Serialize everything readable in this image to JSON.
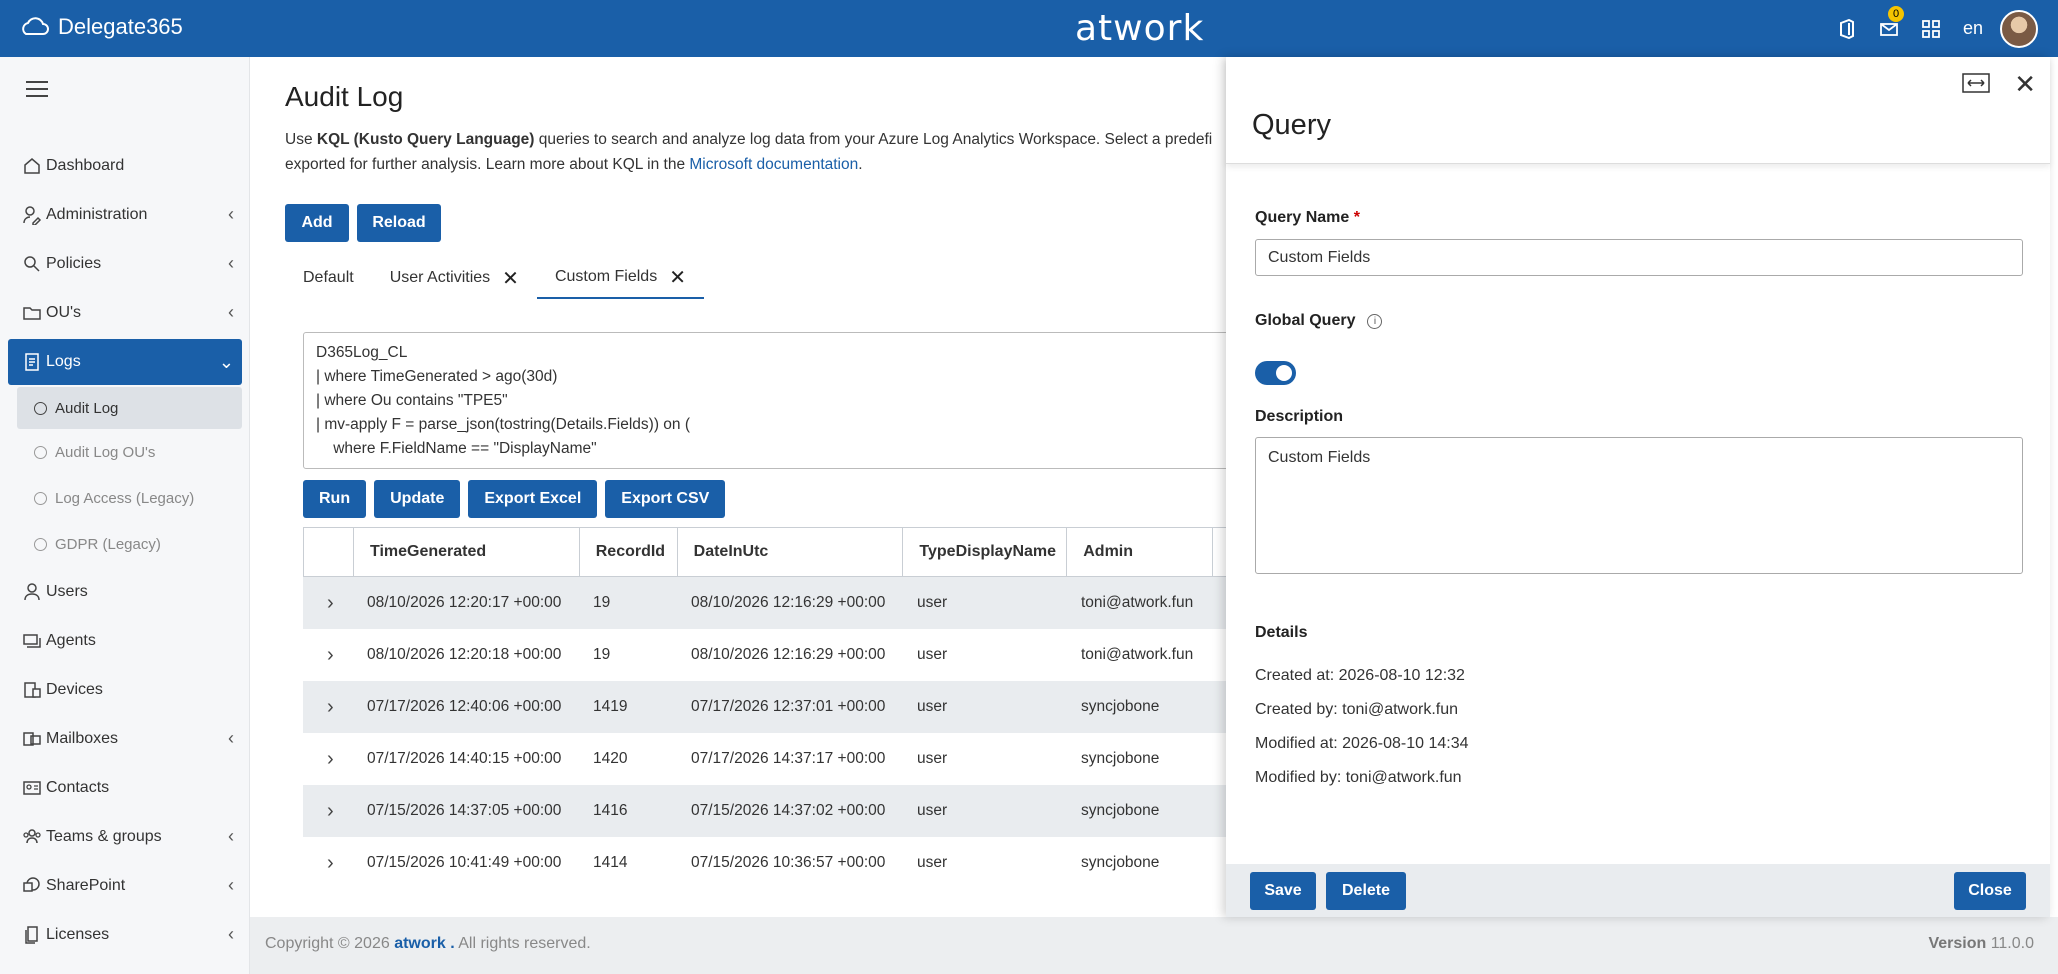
{
  "header": {
    "app_name": "Delegate365",
    "logo": "atwork",
    "notification_count": "0",
    "language": "en"
  },
  "sidebar": {
    "items": [
      {
        "label": "Dashboard",
        "icon": "home-icon"
      },
      {
        "label": "Administration",
        "icon": "admin-icon"
      },
      {
        "label": "Policies",
        "icon": "policies-icon"
      },
      {
        "label": "OU's",
        "icon": "folder-icon"
      },
      {
        "label": "Logs",
        "icon": "logs-icon"
      },
      {
        "label": "Users",
        "icon": "user-icon"
      },
      {
        "label": "Agents",
        "icon": "agents-icon"
      },
      {
        "label": "Devices",
        "icon": "devices-icon"
      },
      {
        "label": "Mailboxes",
        "icon": "mailboxes-icon"
      },
      {
        "label": "Contacts",
        "icon": "contacts-icon"
      },
      {
        "label": "Teams & groups",
        "icon": "teams-icon"
      },
      {
        "label": "SharePoint",
        "icon": "sharepoint-icon"
      },
      {
        "label": "Licenses",
        "icon": "licenses-icon"
      }
    ],
    "logs_sub": [
      "Audit Log",
      "Audit Log OU's",
      "Log Access (Legacy)",
      "GDPR (Legacy)"
    ]
  },
  "main": {
    "title": "Audit Log",
    "desc_prefix": "Use ",
    "desc_bold": "KQL (Kusto Query Language)",
    "desc_rest": " queries to search and analyze log data from your Azure Log Analytics Workspace. Select a predefi",
    "desc_line2": "exported for further analysis. Learn more about KQL in the ",
    "desc_link": "Microsoft documentation",
    "desc_end": ".",
    "add_label": "Add",
    "reload_label": "Reload",
    "tabs": [
      "Default",
      "User Activities",
      "Custom Fields"
    ],
    "query_text": "D365Log_CL\n| where TimeGenerated > ago(30d)\n| where Ou contains \"TPE5\"\n| mv-apply F = parse_json(tostring(Details.Fields)) on (\n    where F.FieldName == \"DisplayName\"",
    "run_label": "Run",
    "update_label": "Update",
    "export_excel_label": "Export Excel",
    "export_csv_label": "Export CSV",
    "columns": [
      "TimeGenerated",
      "RecordId",
      "DateInUtc",
      "TypeDisplayName",
      "Admin"
    ],
    "rows": [
      [
        "08/10/2026 12:20:17 +00:00",
        "19",
        "08/10/2026 12:16:29 +00:00",
        "user",
        "toni@atwork.fun"
      ],
      [
        "08/10/2026 12:20:18 +00:00",
        "19",
        "08/10/2026 12:16:29 +00:00",
        "user",
        "toni@atwork.fun"
      ],
      [
        "07/17/2026 12:40:06 +00:00",
        "1419",
        "07/17/2026 12:37:01 +00:00",
        "user",
        "syncjobone"
      ],
      [
        "07/17/2026 14:40:15 +00:00",
        "1420",
        "07/17/2026 14:37:17 +00:00",
        "user",
        "syncjobone"
      ],
      [
        "07/15/2026 14:37:05 +00:00",
        "1416",
        "07/15/2026 14:37:02 +00:00",
        "user",
        "syncjobone"
      ],
      [
        "07/15/2026 10:41:49 +00:00",
        "1414",
        "07/15/2026 10:36:57 +00:00",
        "user",
        "syncjobone"
      ]
    ]
  },
  "footer": {
    "copyright_prefix": "Copyright © 2026 ",
    "copyright_brand": "atwork .",
    "copyright_rest": " All rights reserved.",
    "version_label": "Version",
    "version": " 11.0.0"
  },
  "panel": {
    "title": "Query",
    "query_name_label": "Query Name",
    "required_mark": "*",
    "query_name_value": "Custom Fields",
    "global_query_label": "Global Query",
    "global_query_on": true,
    "description_label": "Description",
    "description_value": "Custom Fields",
    "details_label": "Details",
    "created_at": "Created at: 2026-08-10 12:32",
    "created_by": "Created by: toni@atwork.fun",
    "modified_at": "Modified at: 2026-08-10 14:34",
    "modified_by": "Modified by: toni@atwork.fun",
    "save_label": "Save",
    "delete_label": "Delete",
    "close_label": "Close"
  },
  "colors": {
    "primary": "#1a5fa8",
    "sidebar_bg": "#f6f7f9",
    "row_alt": "#e9ecef"
  }
}
